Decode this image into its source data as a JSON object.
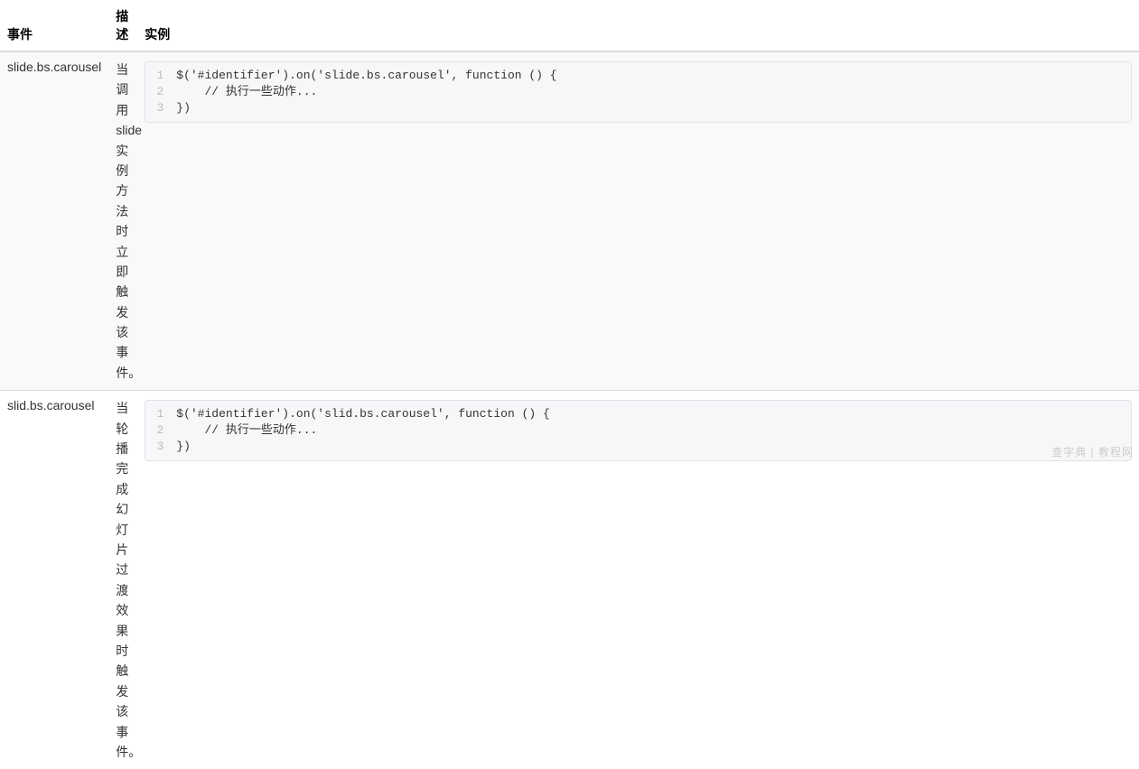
{
  "table": {
    "headers": {
      "event": "事件",
      "desc": "描述",
      "example": "实例"
    },
    "rows": [
      {
        "event": "slide.bs.carousel",
        "desc": "当调用 slide 实例方法时立即触发该事件。",
        "code": [
          "$('#identifier').on('slide.bs.carousel', function () {",
          "    // 执行一些动作...",
          "})"
        ]
      },
      {
        "event": "slid.bs.carousel",
        "desc": "当轮播完成幻灯片过渡效果时触发该事件。",
        "code": [
          "$('#identifier').on('slid.bs.carousel', function () {",
          "    // 执行一些动作...",
          "})"
        ]
      }
    ]
  },
  "watermark": "查字典 | 教程网"
}
